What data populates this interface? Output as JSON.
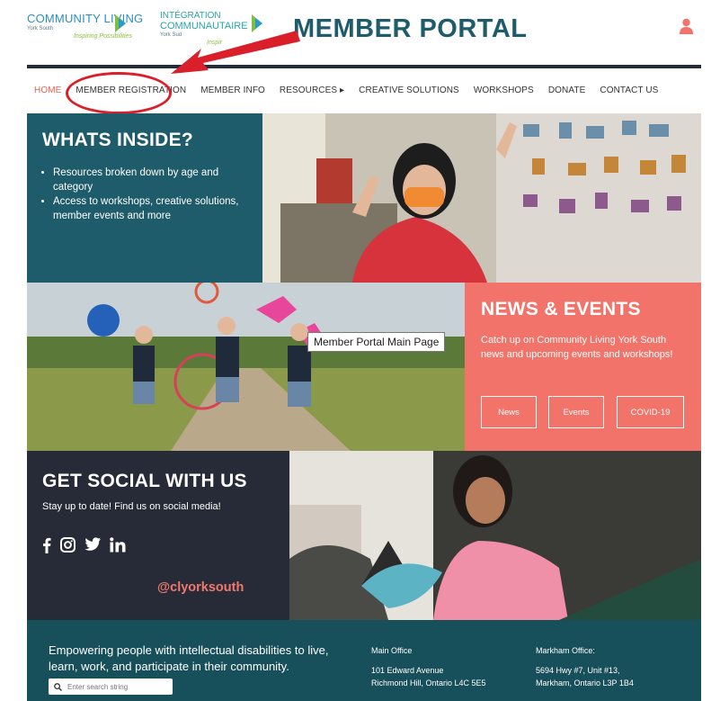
{
  "header": {
    "logo_left": {
      "line1": "COMMUNITY LIVING",
      "sub": "York South",
      "tag": "Inspiring Possibilities"
    },
    "logo_right": {
      "line1": "INTÉGRATION",
      "line2": "COMMUNAUTAIRE",
      "sub": "York Sud",
      "tag": "Inspir"
    },
    "title": "MEMBER PORTAL",
    "user_icon": "user-icon"
  },
  "nav": {
    "items": [
      {
        "label": "HOME",
        "active": true
      },
      {
        "label": "MEMBER REGISTRATION"
      },
      {
        "label": "MEMBER INFO"
      },
      {
        "label": "RESOURCES ▸"
      },
      {
        "label": "CREATIVE SOLUTIONS"
      },
      {
        "label": "WORKSHOPS"
      },
      {
        "label": "DONATE"
      },
      {
        "label": "CONTACT US"
      }
    ]
  },
  "whats_inside": {
    "title": "WHATS INSIDE?",
    "bullets": [
      "Resources broken down by age and category",
      "Access to workshops, creative solutions, member events and more"
    ]
  },
  "news": {
    "title": "NEWS & EVENTS",
    "text": "Catch up on Community Living York South news and upcoming events and workshops!",
    "buttons": [
      "News",
      "Events",
      "COVID-19"
    ]
  },
  "tooltip": "Member Portal Main Page",
  "social": {
    "title": "GET SOCIAL WITH US",
    "text": "Stay up to date! Find us on social media!",
    "icons": [
      "facebook-icon",
      "instagram-icon",
      "twitter-icon",
      "linkedin-icon"
    ],
    "handle": "@clyorksouth"
  },
  "footer": {
    "mission": "Empowering people with intellectual disabilities to live, learn, work, and participate in their community.",
    "search_placeholder": "Enter search string",
    "main_office": {
      "heading": "Main Office",
      "line1": "101 Edward Avenue",
      "line2": "Richmond Hill, Ontario L4C 5E5"
    },
    "markham_office": {
      "heading": "Markham Office:",
      "line1": "5694 Hwy #7, Unit #13,",
      "line2": "Markham, Ontario L3P 1B4"
    }
  },
  "colors": {
    "teal": "#1f5c6b",
    "coral": "#f1736a",
    "dark": "#272b38",
    "annotation_red": "#d9202a"
  }
}
